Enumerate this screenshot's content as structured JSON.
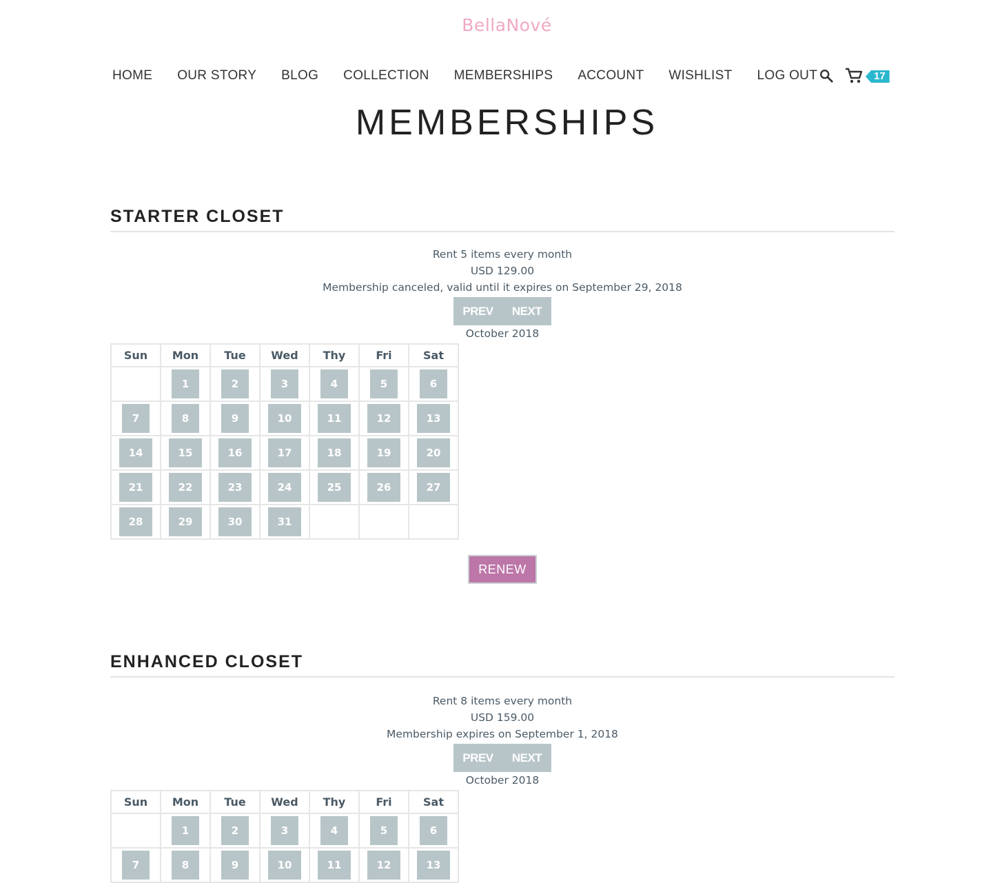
{
  "header": {
    "logo": "BellaNové",
    "nav": [
      "HOME",
      "OUR STORY",
      "BLOG",
      "COLLECTION",
      "MEMBERSHIPS",
      "ACCOUNT",
      "WISHLIST",
      "LOG OUT"
    ],
    "cart_count": "17"
  },
  "page_title": "MEMBERSHIPS",
  "calendar_headers": [
    "Sun",
    "Mon",
    "Tue",
    "Wed",
    "Thy",
    "Fri",
    "Sat"
  ],
  "memberships": [
    {
      "title": "STARTER CLOSET",
      "line1": "Rent 5 items every month",
      "price": "USD 129.00",
      "status": "Membership canceled, valid until it expires on September 29, 2018",
      "prev_label": "PREV",
      "next_label": "NEXT",
      "month": "October 2018",
      "weeks": [
        [
          "",
          "1",
          "2",
          "3",
          "4",
          "5",
          "6"
        ],
        [
          "7",
          "8",
          "9",
          "10",
          "11",
          "12",
          "13"
        ],
        [
          "14",
          "15",
          "16",
          "17",
          "18",
          "19",
          "20"
        ],
        [
          "21",
          "22",
          "23",
          "24",
          "25",
          "26",
          "27"
        ],
        [
          "28",
          "29",
          "30",
          "31",
          "",
          "",
          ""
        ]
      ],
      "renew_label": "RENEW"
    },
    {
      "title": "ENHANCED CLOSET",
      "line1": "Rent 8 items every month",
      "price": "USD 159.00",
      "status": "Membership expires on September 1, 2018",
      "prev_label": "PREV",
      "next_label": "NEXT",
      "month": "October 2018",
      "weeks": [
        [
          "",
          "1",
          "2",
          "3",
          "4",
          "5",
          "6"
        ],
        [
          "7",
          "8",
          "9",
          "10",
          "11",
          "12",
          "13"
        ]
      ]
    }
  ],
  "colors": {
    "logo": "#f0a8c4",
    "day_button": "#b8c5c8",
    "renew_button": "#bd76a8",
    "cart_badge": "#2ab7cf"
  },
  "icons": [
    "search-icon",
    "cart-icon"
  ]
}
